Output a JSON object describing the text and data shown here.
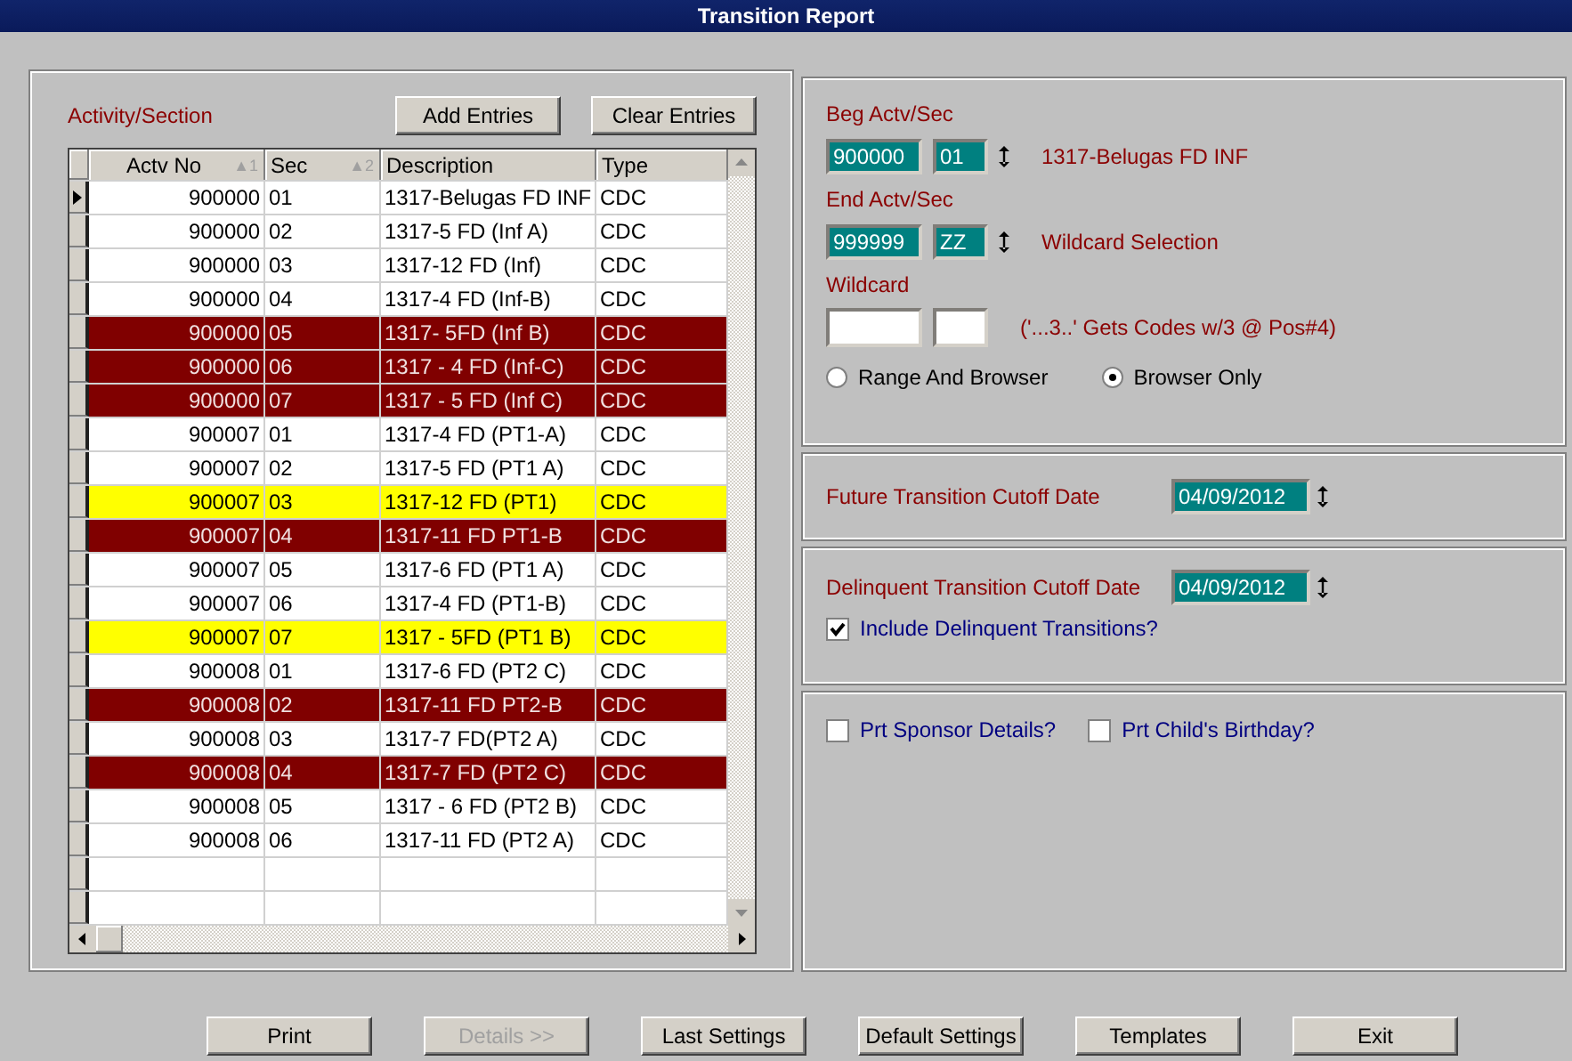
{
  "window": {
    "title": "Transition Report"
  },
  "activity": {
    "label": "Activity/Section",
    "buttons": [
      {
        "label": "Add Entries",
        "disabled": false
      },
      {
        "label": "Clear Entries",
        "disabled": false
      }
    ]
  },
  "table": {
    "columns": [
      {
        "label": "Actv No",
        "sort": "▲1"
      },
      {
        "label": "Sec",
        "sort": "▲2"
      },
      {
        "label": "Description"
      },
      {
        "label": "Type"
      }
    ],
    "rows": [
      {
        "cells": [
          "900000",
          "01",
          "1317-Belugas FD INF",
          "CDC"
        ],
        "color": "#ffffff",
        "current": true
      },
      {
        "cells": [
          "900000",
          "02",
          "1317-5 FD (Inf A)",
          "CDC"
        ],
        "color": "#ffffff",
        "current": false
      },
      {
        "cells": [
          "900000",
          "03",
          "1317-12 FD (Inf)",
          "CDC"
        ],
        "color": "#ffffff",
        "current": false
      },
      {
        "cells": [
          "900000",
          "04",
          "1317-4 FD (Inf-B)",
          "CDC"
        ],
        "color": "#ffffff",
        "current": false
      },
      {
        "cells": [
          "900000",
          "05",
          "1317- 5FD (Inf B)",
          "CDC"
        ],
        "color": "#800000",
        "current": false
      },
      {
        "cells": [
          "900000",
          "06",
          "1317 - 4 FD (Inf-C)",
          "CDC"
        ],
        "color": "#800000",
        "current": false
      },
      {
        "cells": [
          "900000",
          "07",
          "1317 - 5 FD (Inf C)",
          "CDC"
        ],
        "color": "#800000",
        "current": false
      },
      {
        "cells": [
          "900007",
          "01",
          "1317-4 FD (PT1-A)",
          "CDC"
        ],
        "color": "#ffffff",
        "current": false
      },
      {
        "cells": [
          "900007",
          "02",
          "1317-5 FD (PT1 A)",
          "CDC"
        ],
        "color": "#ffffff",
        "current": false
      },
      {
        "cells": [
          "900007",
          "03",
          "1317-12 FD (PT1)",
          "CDC"
        ],
        "color": "#ffff00",
        "current": false
      },
      {
        "cells": [
          "900007",
          "04",
          "1317-11 FD PT1-B",
          "CDC"
        ],
        "color": "#800000",
        "current": false
      },
      {
        "cells": [
          "900007",
          "05",
          "1317-6 FD (PT1 A)",
          "CDC"
        ],
        "color": "#ffffff",
        "current": false
      },
      {
        "cells": [
          "900007",
          "06",
          "1317-4 FD (PT1-B)",
          "CDC"
        ],
        "color": "#ffffff",
        "current": false
      },
      {
        "cells": [
          "900007",
          "07",
          "1317 - 5FD (PT1 B)",
          "CDC"
        ],
        "color": "#ffff00",
        "current": false
      },
      {
        "cells": [
          "900008",
          "01",
          "1317-6 FD (PT2 C)",
          "CDC"
        ],
        "color": "#ffffff",
        "current": false
      },
      {
        "cells": [
          "900008",
          "02",
          "1317-11 FD PT2-B",
          "CDC"
        ],
        "color": "#800000",
        "current": false
      },
      {
        "cells": [
          "900008",
          "03",
          "1317-7 FD(PT2 A)",
          "CDC"
        ],
        "color": "#ffffff",
        "current": false
      },
      {
        "cells": [
          "900008",
          "04",
          "1317-7 FD (PT2 C)",
          "CDC"
        ],
        "color": "#800000",
        "current": false
      },
      {
        "cells": [
          "900008",
          "05",
          "1317 - 6 FD (PT2 B)",
          "CDC"
        ],
        "color": "#ffffff",
        "current": false
      },
      {
        "cells": [
          "900008",
          "06",
          "1317-11 FD (PT2 A)",
          "CDC"
        ],
        "color": "#ffffff",
        "current": false
      }
    ]
  },
  "range": {
    "beg_label": "Beg Actv/Sec",
    "beg_activity": "900000",
    "beg_section": "01",
    "beg_description": "1317-Belugas FD INF",
    "end_label": "End Actv/Sec",
    "end_activity": "999999",
    "end_section": "ZZ",
    "end_description": "Wildcard Selection",
    "wildcard_label": "Wildcard",
    "wildcard_hint": "('...3..' Gets Codes w/3 @ Pos#4)",
    "modes": [
      {
        "label": "Range And Browser",
        "selected": false
      },
      {
        "label": "Browser Only",
        "selected": true
      }
    ]
  },
  "future": {
    "label": "Future Transition Cutoff Date",
    "value": "04/09/2012"
  },
  "delinquent": {
    "label": "Delinquent Transition Cutoff Date",
    "value": "04/09/2012",
    "include": {
      "label": "Include Delinquent Transitions?",
      "checked": true
    }
  },
  "options": [
    {
      "label": "Prt Sponsor Details?",
      "checked": false
    },
    {
      "label": "Prt Child's Birthday?",
      "checked": false
    }
  ],
  "buttons": [
    {
      "label": "Print",
      "disabled": false
    },
    {
      "label": "Details >>",
      "disabled": true
    },
    {
      "label": "Last Settings",
      "disabled": false
    },
    {
      "label": "Default Settings",
      "disabled": false
    },
    {
      "label": "Templates",
      "disabled": false
    },
    {
      "label": "Exit",
      "disabled": false
    }
  ]
}
